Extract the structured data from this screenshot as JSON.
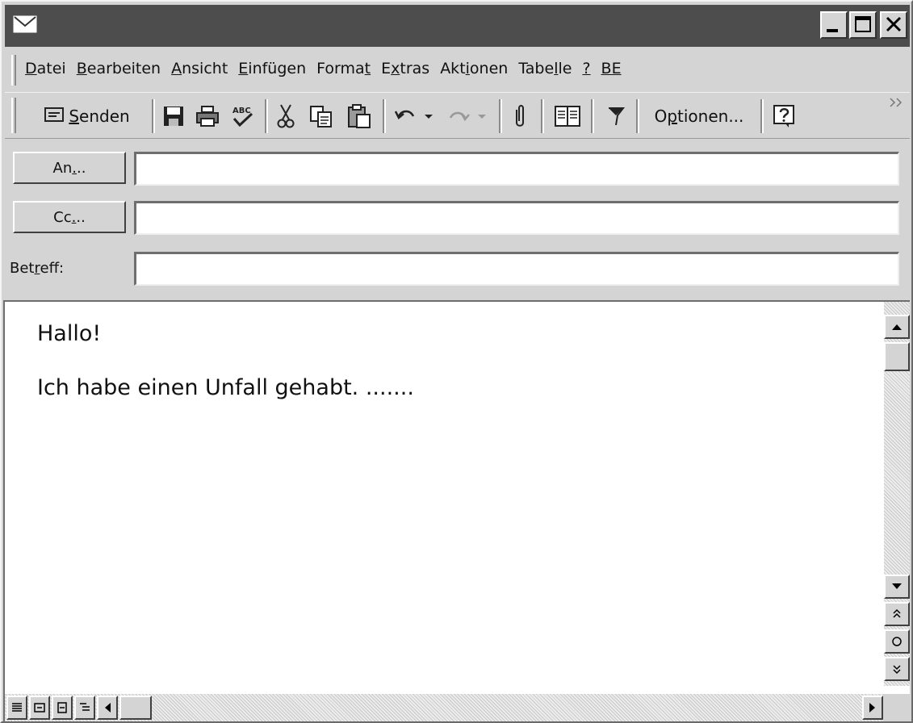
{
  "menu": {
    "items": [
      {
        "before": "",
        "key": "D",
        "after": "atei"
      },
      {
        "before": "",
        "key": "B",
        "after": "earbeiten"
      },
      {
        "before": "",
        "key": "A",
        "after": "nsicht"
      },
      {
        "before": "",
        "key": "E",
        "after": "infügen"
      },
      {
        "before": "Forma",
        "key": "t",
        "after": ""
      },
      {
        "before": "E",
        "key": "x",
        "after": "tras"
      },
      {
        "before": "Akt",
        "key": "i",
        "after": "onen"
      },
      {
        "before": "Tabe",
        "key": "l",
        "after": "le"
      },
      {
        "before": "",
        "key": "?",
        "after": ""
      },
      {
        "before": "",
        "key": "BE",
        "after": ""
      }
    ]
  },
  "toolbar": {
    "send": {
      "key": "S",
      "rest": "enden"
    },
    "options": {
      "before": "O",
      "key": "p",
      "after": "tionen..."
    }
  },
  "header": {
    "to": {
      "before": "An",
      "key": ".",
      "after": ".."
    },
    "cc": {
      "before": "Cc",
      "key": ".",
      "after": ".."
    },
    "subject": {
      "before": "Bet",
      "key": "r",
      "after": "eff:"
    },
    "to_value": "",
    "cc_value": "",
    "subject_value": ""
  },
  "body": {
    "line1": "Hallo!",
    "line2": "Ich habe einen Unfall gehabt. ......."
  },
  "colors": {
    "titlebar": "#4d4d4d",
    "window": "#d4d4d4"
  }
}
